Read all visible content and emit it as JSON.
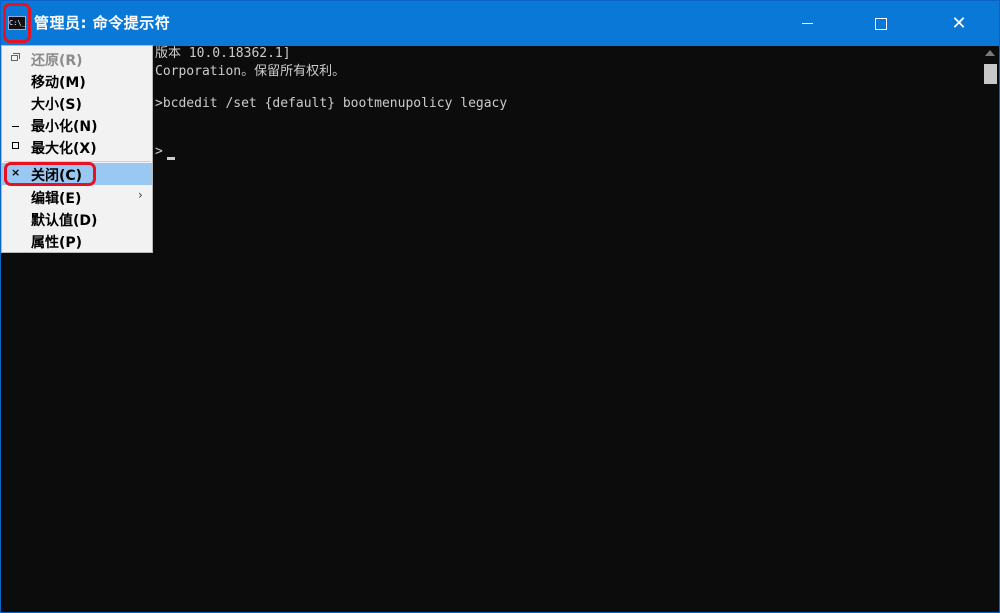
{
  "window": {
    "title": "管理员: 命令提示符",
    "icon_label": "C:\\_",
    "icon": "cmd-icon",
    "close_glyph": "✕"
  },
  "console": {
    "lines": [
      "版本 10.0.18362.1]",
      "Corporation。保留所有权利。",
      ">bcdedit /set {default} bootmenupolicy legacy",
      ">"
    ]
  },
  "system_menu": {
    "items": [
      {
        "label": "还原(R)",
        "icon": "restore-icon",
        "enabled": false
      },
      {
        "label": "移动(M)",
        "enabled": true
      },
      {
        "label": "大小(S)",
        "enabled": true
      },
      {
        "label": "最小化(N)",
        "icon": "minimize-icon",
        "enabled": true
      },
      {
        "label": "最大化(X)",
        "icon": "maximize-icon",
        "enabled": true
      },
      {
        "label": "关闭(C)",
        "icon": "close-icon",
        "mark": "×",
        "enabled": true,
        "highlighted": true
      },
      {
        "label": "编辑(E)",
        "submenu_arrow": "›",
        "enabled": true
      },
      {
        "label": "默认值(D)",
        "enabled": true
      },
      {
        "label": "属性(P)",
        "enabled": true
      }
    ]
  },
  "colors": {
    "titlebar": "#0a78d7",
    "console_bg": "#0c0c0c",
    "console_text": "#cccccc",
    "menu_bg": "#f2f2f2",
    "menu_highlight": "#99c9f2",
    "annotation": "#e81123"
  }
}
